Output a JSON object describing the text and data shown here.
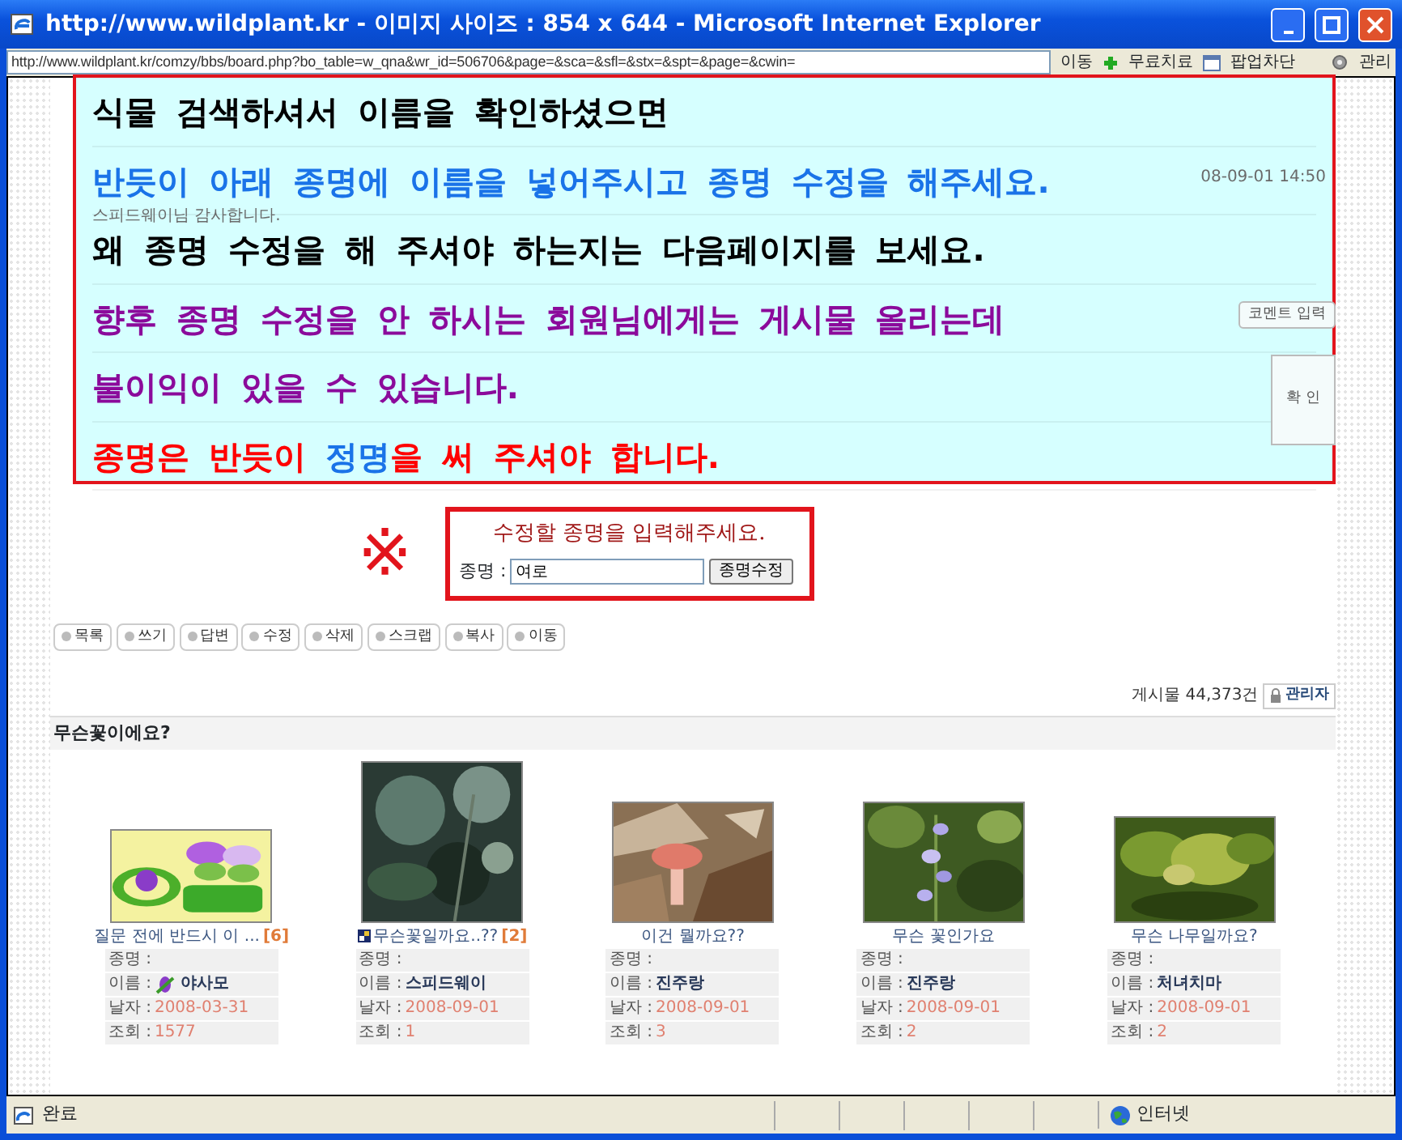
{
  "window": {
    "title": "http://www.wildplant.kr - 이미지 사이즈 : 854 x 644 - Microsoft Internet Explorer"
  },
  "toolbar": {
    "address": "http://www.wildplant.kr/comzy/bbs/board.php?bo_table=w_qna&wr_id=506706&page=&sca=&sfl=&stx=&spt=&page=&cwin=",
    "go": "이동",
    "cure": "무료치료",
    "popup": "팝업차단",
    "manage": "관리"
  },
  "comment": {
    "time": "08-09-01 14:50",
    "text": "스피드웨이님 감사합니다.",
    "input_button": "코멘트 입력",
    "confirm_button": "확 인"
  },
  "notice": {
    "lines": [
      {
        "segments": [
          {
            "text": "식물 검색하셔서 이름을 확인하셨으면",
            "color": "#000000"
          }
        ]
      },
      {
        "segments": [
          {
            "text": "반듯이 아래 종명에 이름을 넣어주시고 종명 수정을 해주세요.",
            "color": "#1a73e8"
          }
        ]
      },
      {
        "segments": [
          {
            "text": "왜 종명 수정을 해 주셔야 하는지는 다음페이지를 보세요.",
            "color": "#000000"
          }
        ]
      },
      {
        "segments": [
          {
            "text": "향후 종명 수정을 안 하시는 회원님에게는 게시물 올리는데",
            "color": "#8b0a9b"
          }
        ]
      },
      {
        "segments": [
          {
            "text": "불이익이 있을 수 있습니다.",
            "color": "#8b0a9b"
          }
        ]
      },
      {
        "segments": [
          {
            "text": "종명은 반듯이 ",
            "color": "#ff0000"
          },
          {
            "text": "정명",
            "color": "#1a73e8"
          },
          {
            "text": "을 써 주셔야 합니다.",
            "color": "#ff0000"
          }
        ]
      }
    ]
  },
  "mark": "※",
  "rename_form": {
    "title": "수정할 종명을 입력해주세요.",
    "label": "종명 :",
    "value": "여로",
    "button": "종명수정"
  },
  "actions": [
    "목록",
    "쓰기",
    "답변",
    "수정",
    "삭제",
    "스크랩",
    "복사",
    "이동"
  ],
  "post_count": "게시물 44,373건",
  "admin_button": "관리자",
  "board_title": "무슨꽃이에요?",
  "posts": [
    {
      "title": "질문 전에 반드시 이 ...",
      "comments": "[6]",
      "title_icon": false,
      "species": "종명 :",
      "name_label": "이름 :",
      "name": "야사모",
      "name_icon": true,
      "date_label": "날자 :",
      "date": "2008-03-31",
      "views_label": "조회 :",
      "views": "1577"
    },
    {
      "title": "무슨꽃일까요..??",
      "comments": "[2]",
      "title_icon": true,
      "species": "종명 :",
      "name_label": "이름 :",
      "name": "스피드웨이",
      "name_icon": false,
      "date_label": "날자 :",
      "date": "2008-09-01",
      "views_label": "조회 :",
      "views": "1"
    },
    {
      "title": "이건 뭘까요??",
      "title_icon": false,
      "species": "종명 :",
      "name_label": "이름 :",
      "name": "진주랑",
      "name_icon": false,
      "date_label": "날자 :",
      "date": "2008-09-01",
      "views_label": "조회 :",
      "views": "3"
    },
    {
      "title": "무슨 꽃인가요",
      "title_icon": false,
      "species": "종명 :",
      "name_label": "이름 :",
      "name": "진주랑",
      "name_icon": false,
      "date_label": "날자 :",
      "date": "2008-09-01",
      "views_label": "조회 :",
      "views": "2"
    },
    {
      "title": "무슨 나무일까요?",
      "title_icon": false,
      "species": "종명 :",
      "name_label": "이름 :",
      "name": "처녀치마",
      "name_icon": false,
      "date_label": "날자 :",
      "date": "2008-09-01",
      "views_label": "조회 :",
      "views": "2"
    }
  ],
  "status": {
    "text": "완료",
    "zone": "인터넷"
  }
}
